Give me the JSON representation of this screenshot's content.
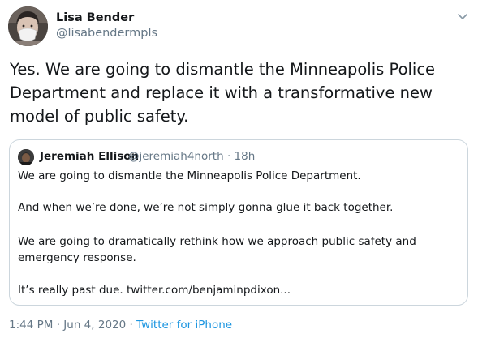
{
  "author": {
    "name": "Lisa Bender",
    "handle": "@lisabendermpls"
  },
  "tweet": {
    "text": "Yes. We are going to dismantle the Minneapolis Police Department and replace it with a transformative new model of public safety."
  },
  "quoted": {
    "name": "Jeremiah Ellison",
    "handle": "@jeremiah4north",
    "separator": "·",
    "age": "18h",
    "lines": [
      "We are going to dismantle the Minneapolis Police Department.",
      "And when we’re done, we’re not simply gonna glue it back together.",
      "We are going to dramatically rethink how we approach public safety and emergency response.",
      "It’s really past due. twitter.com/benjaminpdixon..."
    ]
  },
  "footer": {
    "time": "1:44 PM",
    "separator1": "·",
    "date": "Jun 4, 2020",
    "separator2": "·",
    "source": "Twitter for iPhone"
  },
  "colors": {
    "text": "#14171a",
    "secondary": "#657786",
    "link": "#1b95e0",
    "border": "#ccd6dd"
  },
  "icons": {
    "menu": "chevron-down-icon"
  }
}
